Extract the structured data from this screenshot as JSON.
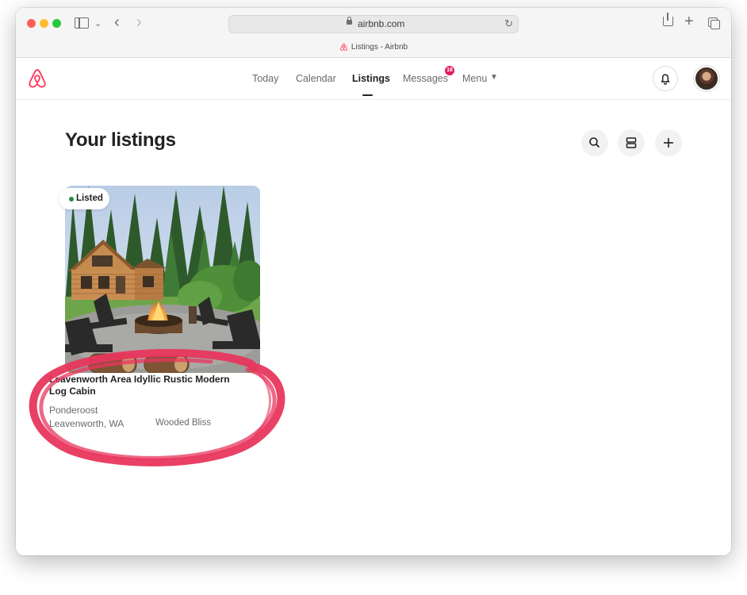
{
  "browser": {
    "url": "airbnb.com",
    "tab_title": "Listings - Airbnb"
  },
  "nav": {
    "today": "Today",
    "calendar": "Calendar",
    "listings": "Listings",
    "messages": "Messages",
    "messages_badge": "18",
    "menu": "Menu"
  },
  "page": {
    "title": "Your listings"
  },
  "listing": {
    "status": "Listed",
    "title": "Leavenworth Area Idyllic Rustic Modern Log Cabin",
    "property_name": "Ponderoost",
    "location": "Leavenworth, WA",
    "tag": "Wooded Bliss"
  },
  "colors": {
    "brand": "#ff385c",
    "annotation": "#e8365d",
    "status_green": "#1e8e3e",
    "badge": "#e31c5f"
  },
  "icons": [
    "search-icon",
    "list-view-icon",
    "add-icon",
    "bell-icon",
    "chevron-down-icon"
  ]
}
